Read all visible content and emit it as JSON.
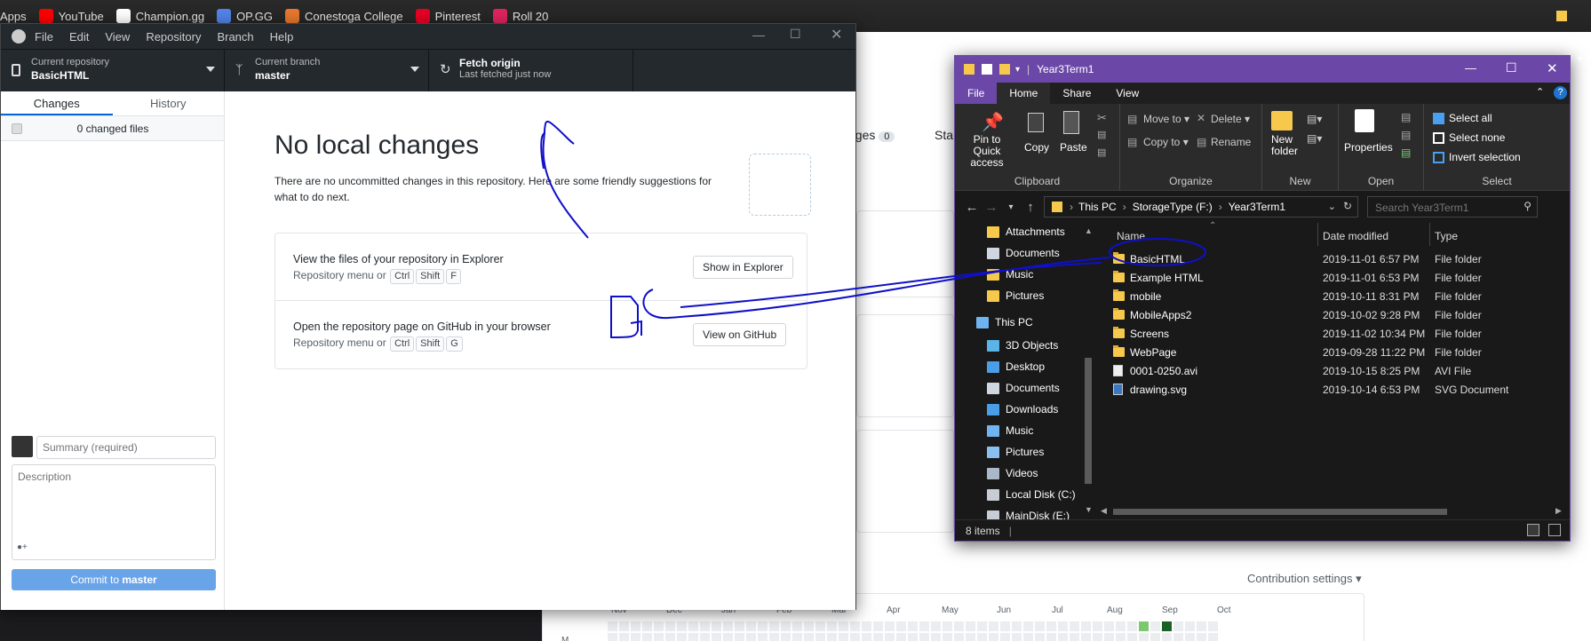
{
  "bookmarks": [
    {
      "label": "Apps",
      "icon": "apps-icon",
      "color": "#4285f4"
    },
    {
      "label": "YouTube",
      "icon": "youtube-icon",
      "color": "#ff0000"
    },
    {
      "label": "Champion.gg",
      "icon": "championgg-icon",
      "color": "#ffffff"
    },
    {
      "label": "OP.GG",
      "icon": "opgg-icon",
      "color": "#5383e8"
    },
    {
      "label": "Conestoga College",
      "icon": "conestoga-icon",
      "color": "#e8772e"
    },
    {
      "label": "Pinterest",
      "icon": "pinterest-icon",
      "color": "#e60023"
    },
    {
      "label": "Roll 20",
      "icon": "roll20-icon",
      "color": "#e0245e"
    }
  ],
  "github_page": {
    "packages_label": "kages",
    "packages_count": "0",
    "stars_label": "Star",
    "contribution_settings": "Contribution settings ▾",
    "months": [
      "Nov",
      "Dec",
      "Jan",
      "Feb",
      "Mar",
      "Apr",
      "May",
      "Jun",
      "Jul",
      "Aug",
      "Sep",
      "Oct"
    ],
    "day_label": "M"
  },
  "desktop": {
    "menu": [
      "File",
      "Edit",
      "View",
      "Repository",
      "Branch",
      "Help"
    ],
    "toolbar": {
      "repo_label": "Current repository",
      "repo_value": "BasicHTML",
      "branch_label": "Current branch",
      "branch_value": "master",
      "fetch_label": "Fetch origin",
      "fetch_sub": "Last fetched just now"
    },
    "tabs": [
      "Changes",
      "History"
    ],
    "changed_files": "0 changed files",
    "summary_placeholder": "Summary (required)",
    "description_placeholder": "Description",
    "commit_prefix": "Commit to ",
    "commit_branch": "master",
    "main": {
      "heading": "No local changes",
      "desc": "There are no uncommitted changes in this repository. Here are some friendly suggestions for what to do next.",
      "cards": [
        {
          "title": "View the files of your repository in Explorer",
          "hint": "Repository menu or",
          "keys": [
            "Ctrl",
            "Shift",
            "F"
          ],
          "button": "Show in Explorer"
        },
        {
          "title": "Open the repository page on GitHub in your browser",
          "hint": "Repository menu or",
          "keys": [
            "Ctrl",
            "Shift",
            "G"
          ],
          "button": "View on GitHub"
        }
      ]
    }
  },
  "explorer": {
    "title": "Year3Term1",
    "tabs": [
      "File",
      "Home",
      "Share",
      "View"
    ],
    "ribbon": {
      "clipboard": {
        "label": "Clipboard",
        "pin": "Pin to Quick access",
        "copy": "Copy",
        "paste": "Paste"
      },
      "organize": {
        "label": "Organize",
        "move_to": "Move to ▾",
        "copy_to": "Copy to ▾",
        "delete": "Delete ▾",
        "rename": "Rename"
      },
      "new": {
        "label": "New",
        "new_folder": "New folder"
      },
      "open": {
        "label": "Open",
        "properties": "Properties"
      },
      "select": {
        "label": "Select",
        "select_all": "Select all",
        "select_none": "Select none",
        "invert": "Invert selection"
      }
    },
    "breadcrumb": [
      "This PC",
      "StorageType (F:)",
      "Year3Term1"
    ],
    "search_placeholder": "Search Year3Term1",
    "nav": [
      {
        "label": "Attachments",
        "icon": "folder-icon",
        "indent": 1
      },
      {
        "label": "Documents",
        "icon": "documents-icon",
        "indent": 1
      },
      {
        "label": "Music",
        "icon": "folder-icon",
        "indent": 1
      },
      {
        "label": "Pictures",
        "icon": "folder-icon",
        "indent": 1
      },
      {
        "label": "This PC",
        "icon": "computer-icon",
        "indent": 0
      },
      {
        "label": "3D Objects",
        "icon": "3d-objects-icon",
        "indent": 1
      },
      {
        "label": "Desktop",
        "icon": "desktop-icon",
        "indent": 1
      },
      {
        "label": "Documents",
        "icon": "documents-icon",
        "indent": 1
      },
      {
        "label": "Downloads",
        "icon": "downloads-icon",
        "indent": 1
      },
      {
        "label": "Music",
        "icon": "music-icon",
        "indent": 1
      },
      {
        "label": "Pictures",
        "icon": "pictures-icon",
        "indent": 1
      },
      {
        "label": "Videos",
        "icon": "videos-icon",
        "indent": 1
      },
      {
        "label": "Local Disk (C:)",
        "icon": "drive-icon",
        "indent": 1
      },
      {
        "label": "MainDisk (E:)",
        "icon": "drive-icon",
        "indent": 1
      }
    ],
    "columns": [
      "Name",
      "Date modified",
      "Type"
    ],
    "files": [
      {
        "name": "BasicHTML",
        "date": "2019-11-01 6:57 PM",
        "type": "File folder",
        "kind": "folder"
      },
      {
        "name": "Example HTML",
        "date": "2019-11-01 6:53 PM",
        "type": "File folder",
        "kind": "folder"
      },
      {
        "name": "mobile",
        "date": "2019-10-11 8:31 PM",
        "type": "File folder",
        "kind": "folder"
      },
      {
        "name": "MobileApps2",
        "date": "2019-10-02 9:28 PM",
        "type": "File folder",
        "kind": "folder"
      },
      {
        "name": "Screens",
        "date": "2019-11-02 10:34 PM",
        "type": "File folder",
        "kind": "folder"
      },
      {
        "name": "WebPage",
        "date": "2019-09-28 11:22 PM",
        "type": "File folder",
        "kind": "folder"
      },
      {
        "name": "0001-0250.avi",
        "date": "2019-10-15 8:25 PM",
        "type": "AVI File",
        "kind": "video"
      },
      {
        "name": "drawing.svg",
        "date": "2019-10-14 6:53 PM",
        "type": "SVG Document",
        "kind": "svg"
      }
    ],
    "status": "8 items"
  },
  "colors": {
    "accent": "#0366d6",
    "explorer_title": "#6b48a8",
    "ink": "#1010c8"
  }
}
